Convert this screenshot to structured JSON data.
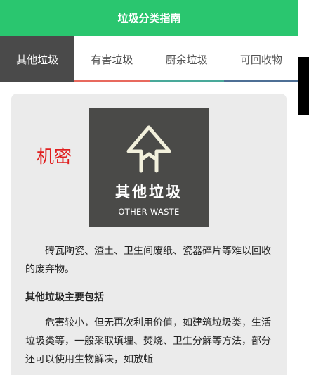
{
  "header": {
    "title": "垃圾分类指南"
  },
  "tabs": [
    {
      "label": "其他垃圾",
      "active": true
    },
    {
      "label": "有害垃圾",
      "active": false,
      "color": "#e8695e"
    },
    {
      "label": "厨余垃圾",
      "active": false,
      "color": "#49a99a"
    },
    {
      "label": "可回收物",
      "active": false,
      "color": "#4e6f95"
    }
  ],
  "card": {
    "stamp": "机密",
    "logo": {
      "icon": "recycle-arrow-icon",
      "title_cn": "其他垃圾",
      "title_en": "OTHER WASTE"
    },
    "description": "砖瓦陶瓷、渣土、卫生间废纸、瓷器碎片等难以回收的废弃物。",
    "subheading": "其他垃圾主要包括",
    "detail": "危害较小，但无再次利用价值，如建筑垃圾类，生活垃圾类等，一般采取填埋、焚烧、卫生分解等方法，部分还可以使用生物解决，如放蚯"
  },
  "colors": {
    "header": "#2ac66f",
    "active_tab": "#4a4a4a",
    "card_bg": "#ebebeb",
    "stamp": "#e02020"
  }
}
